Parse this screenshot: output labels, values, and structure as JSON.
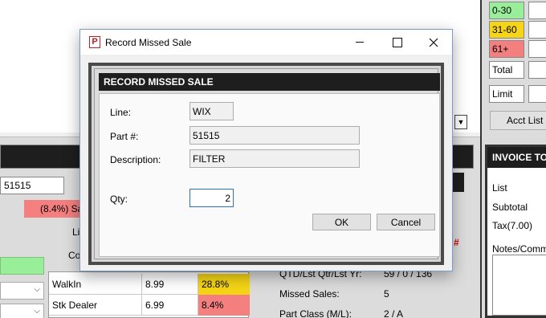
{
  "dialog": {
    "window_title": "Record Missed Sale",
    "app_icon_letter": "P",
    "header": "RECORD MISSED SALE",
    "fields": {
      "line": {
        "label": "Line:",
        "value": "WIX"
      },
      "part": {
        "label": "Part #:",
        "value": "51515"
      },
      "description": {
        "label": "Description:",
        "value": "FILTER"
      },
      "qty": {
        "label": "Qty:",
        "value": "2"
      }
    },
    "ok_label": "OK",
    "cancel_label": "Cancel"
  },
  "background": {
    "part_number": "51515",
    "margin_badge": "(8.4%) Sa",
    "label_li": "Li",
    "label_co": "Co",
    "price_table": [
      {
        "type": "WalkIn",
        "price": "8.99",
        "margin": "28.8%",
        "margin_color": "#f5d515"
      },
      {
        "type": "Stk Dealer",
        "price": "6.99",
        "margin": "8.4%",
        "margin_color": "#f47f7f"
      }
    ],
    "info": [
      {
        "label": "QTD/Lst Qtr/Lst Yr:",
        "value": "59 / 0 / 136"
      },
      {
        "label": "Missed Sales:",
        "value": "5"
      },
      {
        "label": "Part Class (M/L):",
        "value": "2 / A"
      }
    ],
    "hash_mark": "#"
  },
  "right_panel": {
    "aging": [
      {
        "label": "0-30",
        "color": "#99ee99"
      },
      {
        "label": "31-60",
        "color": "#f5d515"
      },
      {
        "label": "61+",
        "color": "#f47f7f"
      }
    ],
    "total_label": "Total",
    "limit_label": "Limit",
    "acct_list_label": "Acct List",
    "invoice_header": "INVOICE TO",
    "invoice_lines": [
      "List",
      "Subtotal",
      "Tax(7.00)"
    ],
    "notes_label": "Notes/Comm"
  }
}
